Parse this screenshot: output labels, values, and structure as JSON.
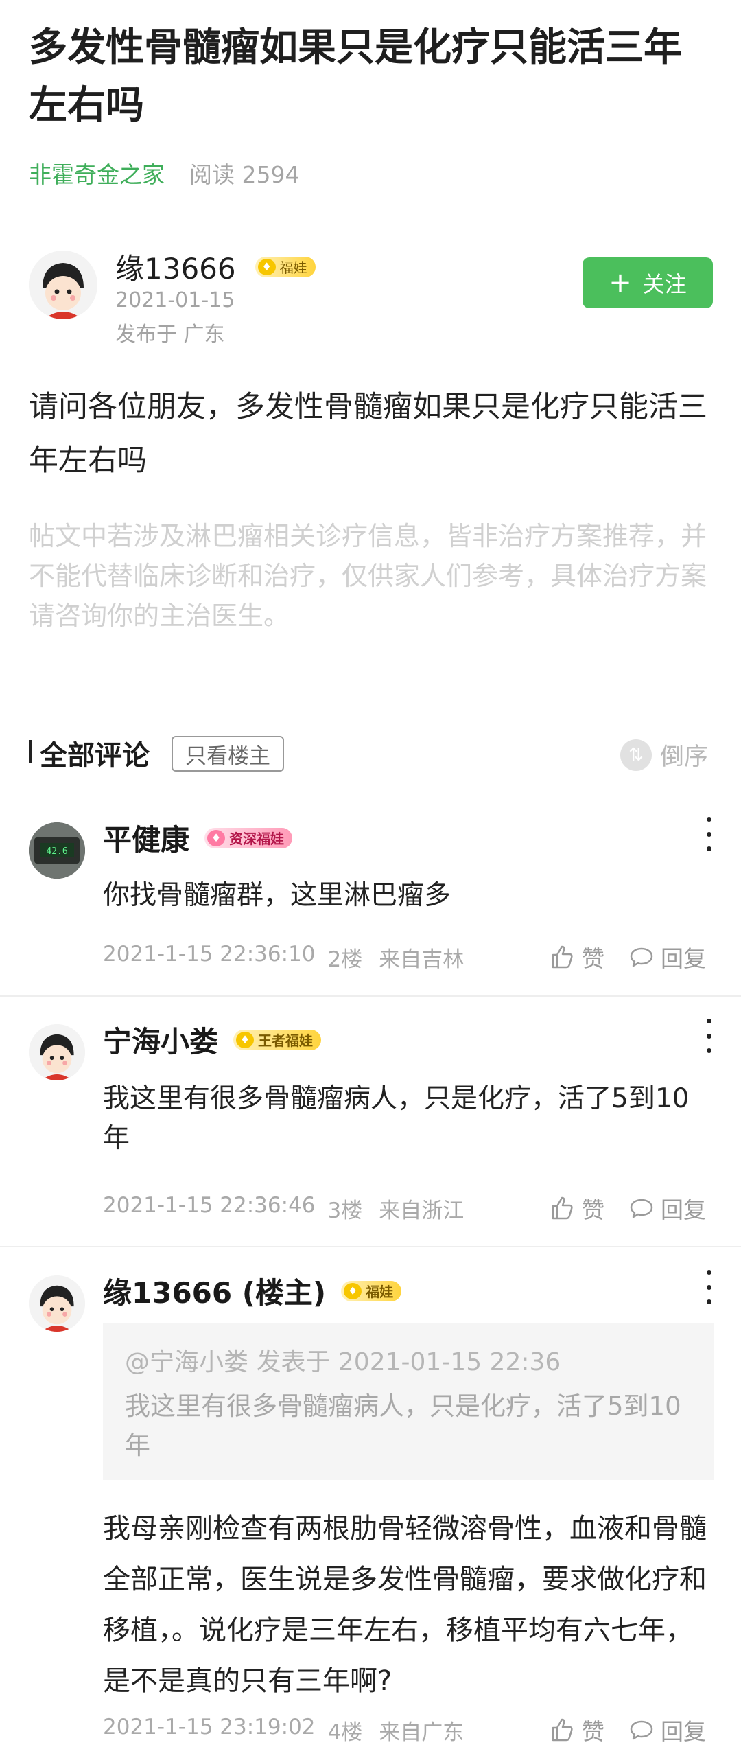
{
  "post": {
    "title": "多发性骨髓瘤如果只是化疗只能活三年左右吗",
    "group": "非霍奇金之家",
    "reads": "阅读 2594",
    "author": "缘13666",
    "author_badge": "福娃",
    "date": "2021-01-15",
    "location": "发布于 广东",
    "follow_label": "关注",
    "body": "请问各位朋友，多发性骨髓瘤如果只是化疗只能活三年左右吗",
    "disclaimer": "帖文中若涉及淋巴瘤相关诊疗信息，皆非治疗方案推荐，并不能代替临床诊断和治疗，仅供家人们参考，具体治疗方案请咨询你的主治医生。"
  },
  "comments_header": {
    "title": "全部评论",
    "only_op": "只看楼主",
    "sort": "倒序"
  },
  "comments": [
    {
      "name": "平健康",
      "badge": "资深福娃",
      "text": "你找骨髓瘤群，这里淋巴瘤多",
      "time": "2021-1-15 22:36:10",
      "floor": "2楼",
      "from": "来自吉林",
      "like": "赞",
      "reply": "回复"
    },
    {
      "name": "宁海小娄",
      "badge": "王者福娃",
      "text": "我这里有很多骨髓瘤病人，只是化疗，活了5到10年",
      "time": "2021-1-15 22:36:46",
      "floor": "3楼",
      "from": "来自浙江",
      "like": "赞",
      "reply": "回复"
    },
    {
      "name": "缘13666 (楼主)",
      "badge": "福娃",
      "quote_head": "@宁海小娄 发表于 2021-01-15 22:36",
      "quote_text": "我这里有很多骨髓瘤病人，只是化疗，活了5到10年",
      "text": "我母亲刚检查有两根肋骨轻微溶骨性，血液和骨髓全部正常，医生说是多发性骨髓瘤，要求做化疗和移植，。说化疗是三年左右，移植平均有六七年，是不是真的只有三年啊?",
      "time": "2021-1-15 23:19:02",
      "floor": "4楼",
      "from": "来自广东",
      "like": "赞",
      "reply": "回复"
    }
  ],
  "colors": {
    "green": "#4bbf5c",
    "group_text": "#3fae5a",
    "badge_gold": "#ffd43d",
    "badge_pink": "#ff9ab7"
  },
  "icons": [
    "plus-icon",
    "sort-icon",
    "thumbs-up-icon",
    "comment-icon",
    "more-icon",
    "shirt-badge-icon"
  ]
}
